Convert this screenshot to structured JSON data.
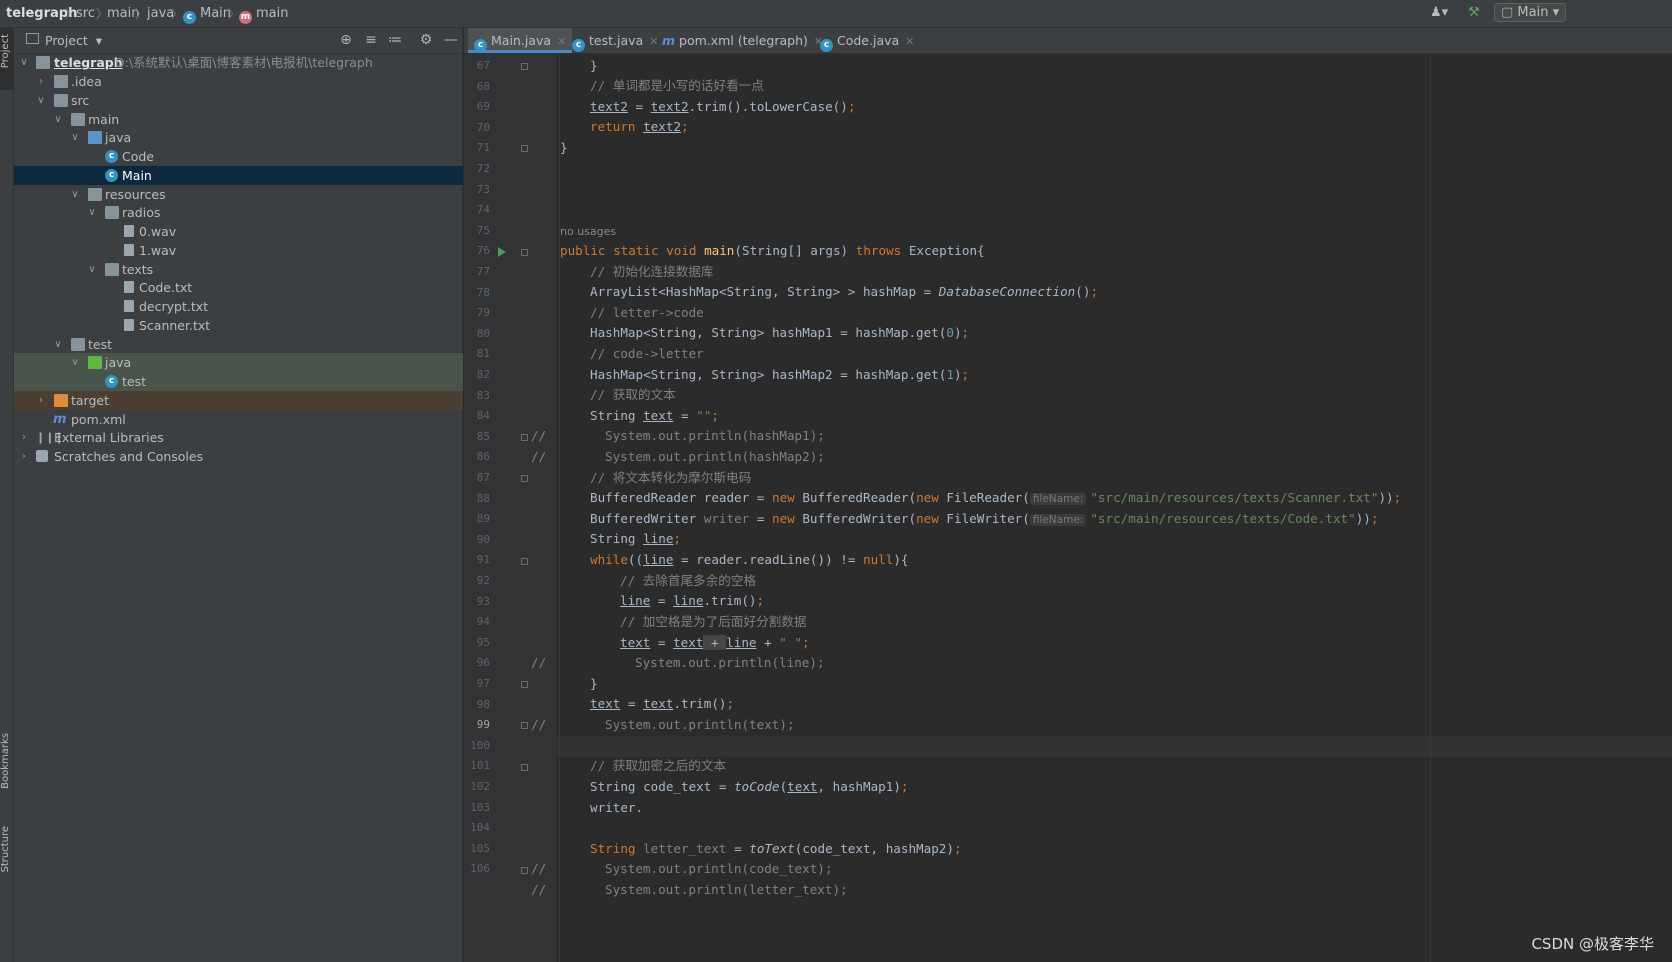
{
  "breadcrumbs": [
    "telegraph",
    "src",
    "main",
    "java",
    "Main",
    "main"
  ],
  "toolbar": {
    "run_config": "Main"
  },
  "stripe": {
    "project": "Project",
    "bookmarks": "Bookmarks",
    "structure": "Structure"
  },
  "project_panel": {
    "title": "Project"
  },
  "tree": {
    "root": {
      "name": "telegraph",
      "path": "D:\\系统默认\\桌面\\博客素材\\电报机\\telegraph"
    },
    "idea": ".idea",
    "src": "src",
    "main": "main",
    "java": "java",
    "code": "Code",
    "main_class": "Main",
    "resources": "resources",
    "radios": "radios",
    "wav0": "0.wav",
    "wav1": "1.wav",
    "texts": "texts",
    "code_txt": "Code.txt",
    "decrypt_txt": "decrypt.txt",
    "scanner_txt": "Scanner.txt",
    "test": "test",
    "test_java": "java",
    "test_class": "test",
    "target": "target",
    "pom": "pom.xml",
    "ext_libs": "External Libraries",
    "scratches": "Scratches and Consoles"
  },
  "tabs": [
    "Main.java",
    "test.java",
    "pom.xml (telegraph)",
    "Code.java"
  ],
  "line_numbers": [
    "67",
    "68",
    "69",
    "70",
    "71",
    "72",
    "73",
    "74",
    "75",
    "76",
    "77",
    "78",
    "79",
    "80",
    "81",
    "82",
    "83",
    "84",
    "85",
    "86",
    "87",
    "88",
    "89",
    "90",
    "91",
    "92",
    "93",
    "94",
    "95",
    "96",
    "97",
    "98",
    "99",
    "100",
    "101",
    "102",
    "103",
    "104",
    "105",
    "106"
  ],
  "code": {
    "c67": "}",
    "c68": "// 单词都是小写的话好看一点",
    "c69_a": "text2",
    "c69_b": " = ",
    "c69_c": "text2",
    "c69_d": ".trim().toLowerCase()",
    "c69_e": ";",
    "c70_a": "return ",
    "c70_b": "text2",
    "c70_c": ";",
    "c71": "}",
    "usage": "no usages",
    "c75_a": "public static void ",
    "c75_b": "main",
    "c75_c": "(String[] args) ",
    "c75_d": "throws ",
    "c75_e": "Exception{",
    "c76": "// 初始化连接数据库",
    "c77_a": "ArrayList<HashMap<String, String> > hashMap = ",
    "c77_b": "DatabaseConnection",
    "c77_c": "()",
    "c77_d": ";",
    "c78": "// letter->code",
    "c79_a": "HashMap<String, String> hashMap1 = hashMap.get(",
    "c79_b": "0",
    "c79_c": ")",
    "c79_d": ";",
    "c80": "// code->letter",
    "c81_a": "HashMap<String, String> hashMap2 = hashMap.get(",
    "c81_b": "1",
    "c81_c": ")",
    "c81_d": ";",
    "c82": "// 获取的文本",
    "c83_a": "String ",
    "c83_b": "text",
    "c83_c": " = ",
    "c83_d": "\"\"",
    "c83_e": ";",
    "slash": "//",
    "c84": "System.out.println(hashMap1);",
    "c85": "System.out.println(hashMap2);",
    "c86": "// 将文本转化为摩尔斯电码",
    "c87_a": "BufferedReader reader = ",
    "c87_b": "new ",
    "c87_c": "BufferedReader(",
    "c87_d": "new ",
    "c87_e": "FileReader(",
    "hint_filename": "fileName:",
    "c87_f": "\"src/main/resources/texts/Scanner.txt\"",
    "c87_g": "))",
    "c87_h": ";",
    "c88_a": "BufferedWriter ",
    "c88_b": "writer",
    "c88_c": " = ",
    "c88_d": "new ",
    "c88_e": "BufferedWriter(",
    "c88_f": "new ",
    "c88_g": "FileWriter(",
    "c88_h": "\"src/main/resources/texts/Code.txt\"",
    "c88_i": "))",
    "c88_j": ";",
    "c89_a": "String ",
    "c89_b": "line",
    "c89_c": ";",
    "c90_a": "while",
    "c90_b": "((",
    "c90_c": "line",
    "c90_d": " = reader.readLine()) != ",
    "c90_e": "null",
    "c90_f": "){",
    "c91": "// 去除首尾多余的空格",
    "c92_a": "line",
    "c92_b": " = ",
    "c92_c": "line",
    "c92_d": ".trim()",
    "c92_e": ";",
    "c93": "// 加空格是为了后面好分割数据",
    "c94_a": "text",
    "c94_b": " = ",
    "c94_c": "text",
    "c94_d": " + ",
    "c94_e": "line",
    "c94_f": " + ",
    "c94_g": "\" \"",
    "c94_h": ";",
    "c95": "System.out.println(line);",
    "c96": "}",
    "c97_a": "text",
    "c97_b": " = ",
    "c97_c": "text",
    "c97_d": ".trim()",
    "c97_e": ";",
    "c98": "System.out.println(text);",
    "c100": "// 获取加密之后的文本",
    "c101_a": "String code_text = ",
    "c101_b": "toCode",
    "c101_c": "(",
    "c101_d": "text",
    "c101_e": ", hashMap1)",
    "c101_f": ";",
    "c102": "writer.",
    "c104_a": "String ",
    "c104_b": "letter_text",
    "c104_c": " = ",
    "c104_d": "toText",
    "c104_e": "(code_text, hashMap2)",
    "c104_f": ";",
    "c105": "System.out.println(code_text);",
    "c106": "System.out.println(letter_text);"
  },
  "watermark": "CSDN @极客李华",
  "colors": {
    "keyword": "#cc7832",
    "string": "#6a8759",
    "comment": "#808080",
    "number": "#6897bb",
    "method": "#ffc66d",
    "selection": "#0d293e"
  }
}
